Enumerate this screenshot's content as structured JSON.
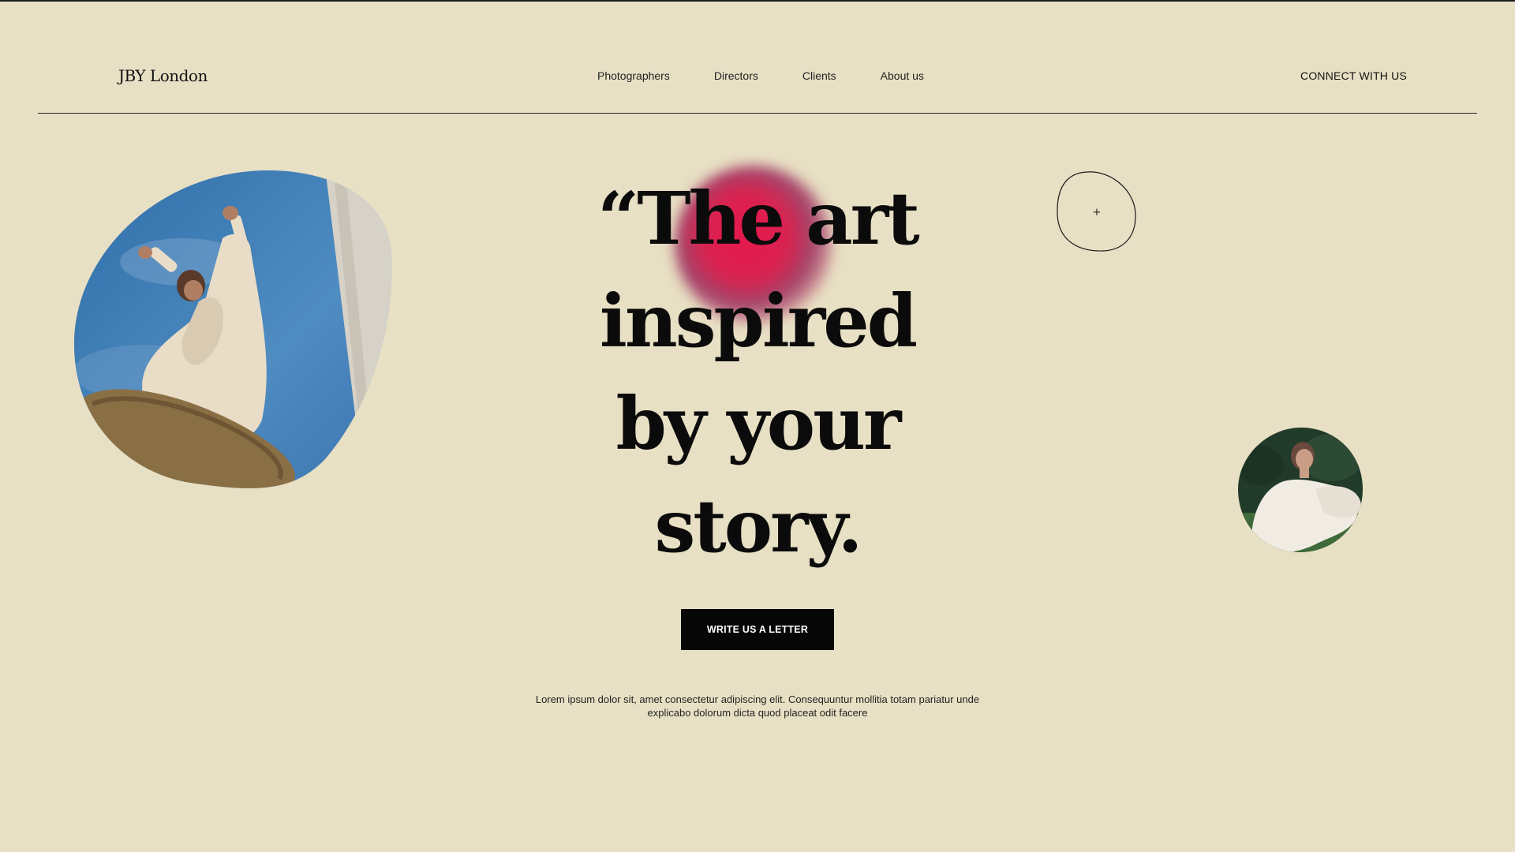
{
  "brand": {
    "logo_text": "JBY London"
  },
  "nav": {
    "items": [
      {
        "label": "Photographers"
      },
      {
        "label": "Directors"
      },
      {
        "label": "Clients"
      },
      {
        "label": "About us"
      }
    ],
    "connect_label": "CONNECT WITH US"
  },
  "hero": {
    "headline_lines": [
      "“The art",
      "inspired",
      "by your",
      "story."
    ],
    "cta_label": "WRITE US A LETTER",
    "description_line1": "Lorem ipsum dolor sit, amet consectetur adipiscing elit. Consequuntur mollitia totam pariatur unde",
    "description_line2": "explicabo dolorum dicta quod placeat odit facere",
    "plus_symbol": "+"
  },
  "icons": {
    "plus": "plus-icon"
  },
  "colors": {
    "background": "#e8e0c4",
    "text": "#111111",
    "cta_bg": "#060606",
    "accent_glow": "#e8184e"
  }
}
